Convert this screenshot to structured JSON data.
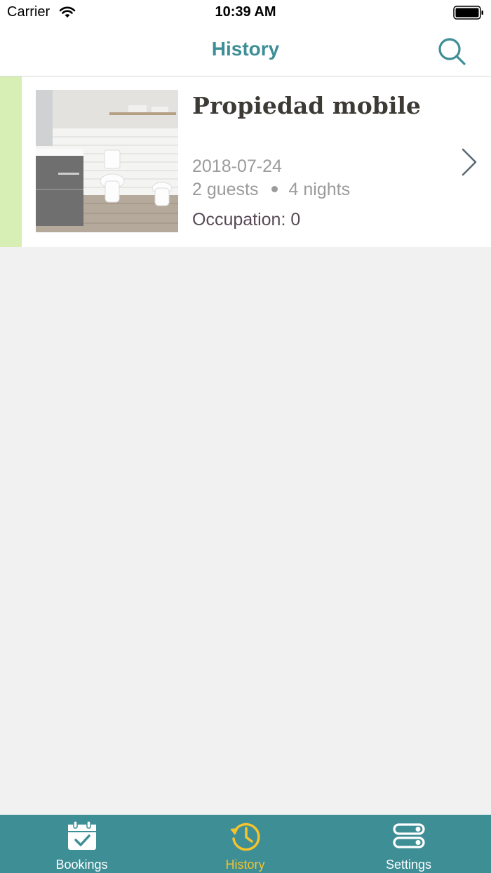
{
  "status_bar": {
    "carrier": "Carrier",
    "time": "10:39 AM",
    "icons": [
      "wifi-icon",
      "battery-icon"
    ]
  },
  "nav": {
    "title": "History",
    "search_icon": "search-icon",
    "accent_color": "#3e8e96"
  },
  "bookings": [
    {
      "property": "Propiedad mobile",
      "date": "2018-07-24",
      "guests": "2 guests",
      "nights": "4 nights",
      "occupation": "Occupation: 0",
      "status_color": "#d7efb4",
      "thumbnail": "bathroom-photo"
    }
  ],
  "tabs": [
    {
      "label": "Bookings",
      "icon": "calendar-check-icon",
      "active": false
    },
    {
      "label": "History",
      "icon": "history-clock-icon",
      "active": true
    },
    {
      "label": "Settings",
      "icon": "settings-toggles-icon",
      "active": false
    }
  ],
  "colors": {
    "tab_bar": "#3e8e96",
    "active_tab": "#f5c32c",
    "background": "#f1f1f1"
  }
}
